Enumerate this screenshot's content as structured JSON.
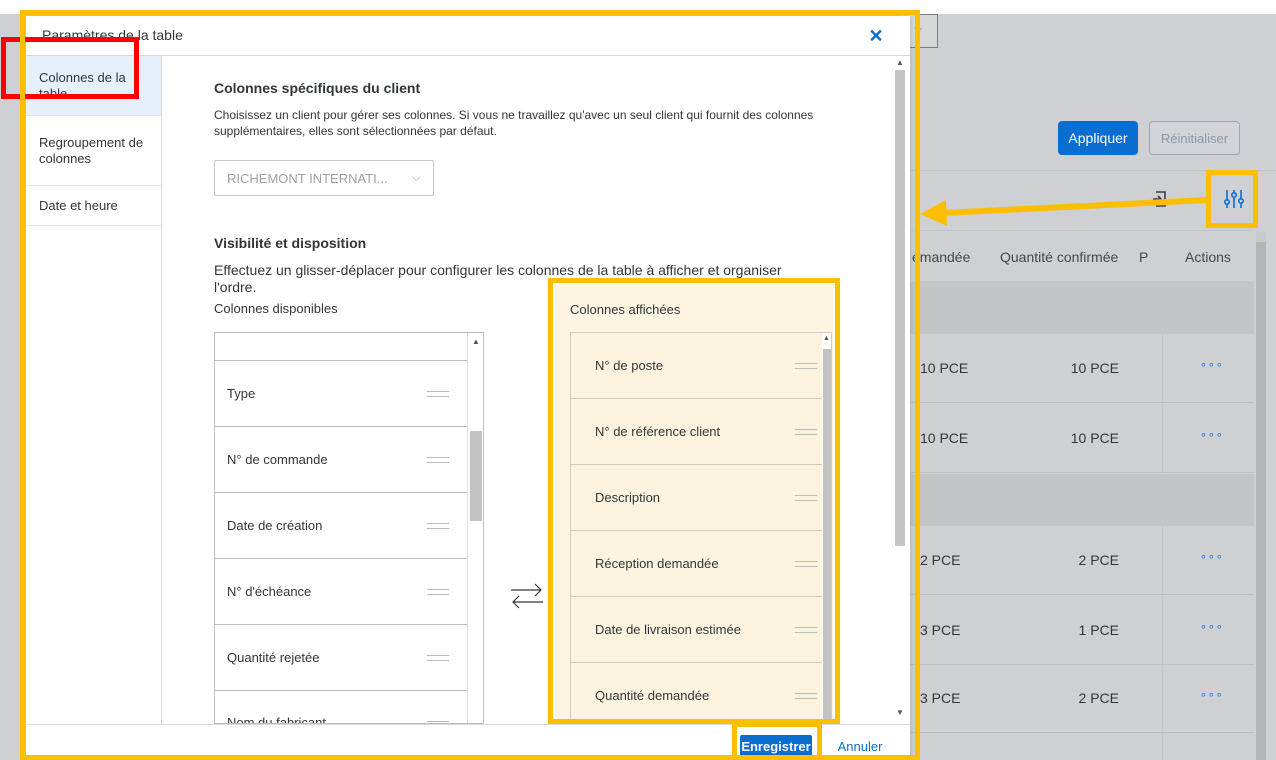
{
  "background": {
    "apply_label": "Appliquer",
    "reset_label": "Réinitialiser",
    "table": {
      "headers": [
        "emandée",
        "Quantité confirmée",
        "P",
        "Actions"
      ],
      "rows": [
        {
          "q1": "10 PCE",
          "q2": "10 PCE",
          "actions": "∘∘∘"
        },
        {
          "q1": "10 PCE",
          "q2": "10 PCE",
          "actions": "∘∘∘"
        },
        {
          "q1": "2 PCE",
          "q2": "2 PCE",
          "actions": "∘∘∘"
        },
        {
          "q1": "3 PCE",
          "q2": "1 PCE",
          "actions": "∘∘∘"
        },
        {
          "q1": "3 PCE",
          "q2": "2 PCE",
          "actions": "∘∘∘"
        }
      ]
    }
  },
  "dialog": {
    "title": "Paramètres de la table",
    "close_glyph": "✕",
    "nav": [
      {
        "label": "Colonnes de la table"
      },
      {
        "label": "Regroupement de colonnes"
      },
      {
        "label": "Date et heure"
      }
    ],
    "client_section": {
      "heading": "Colonnes spécifiques du client",
      "description": "Choisissez un client pour gérer ses colonnes. Si vous ne travaillez qu'avec un seul client qui fournit des colonnes supplémentaires, elles sont sélectionnées par défaut.",
      "select_value": "RICHEMONT INTERNATI...",
      "chevron_glyph": "⌵"
    },
    "visibility_section": {
      "heading": "Visibilité et disposition",
      "description": "Effectuez un glisser-déplacer pour configurer les colonnes de la table à afficher et organiser l'ordre.",
      "available_label": "Colonnes disponibles",
      "available": [
        "Type",
        "N° de commande",
        "Date de création",
        "N° d'échéance",
        "Quantité rejetée",
        "Nom du fabricant"
      ],
      "shown_label": "Colonnes affichées",
      "shown": [
        "N° de poste",
        "N° de référence client",
        "Description",
        "Réception demandée",
        "Date de livraison estimée",
        "Quantité demandée"
      ]
    },
    "footer": {
      "save_label": "Enregistrer",
      "cancel_label": "Annuler"
    }
  },
  "colors": {
    "accent": "#0a6ed1",
    "annotation_yellow": "#fbbe00",
    "annotation_red": "#ff0000",
    "shown_panel_bg": "#fdf5e1"
  },
  "icons": [
    "close-icon",
    "chevron-down-icon",
    "settings-sliders-icon",
    "export-icon",
    "transfer-arrows-icon",
    "drag-handle-icon"
  ]
}
